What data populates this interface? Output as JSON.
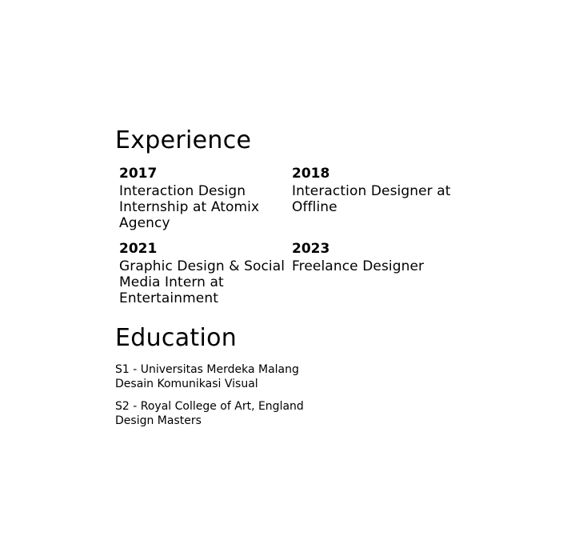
{
  "experience": {
    "title": "Experience",
    "items": [
      {
        "year": "2017",
        "role": "Interaction Design Internship at Atomix Agency"
      },
      {
        "year": "2018",
        "role": "Interaction Designer at Offline"
      },
      {
        "year": "2021",
        "role": "Graphic Design & Social Media Intern at Entertainment"
      },
      {
        "year": "2023",
        "role": "Freelance Designer"
      }
    ]
  },
  "education": {
    "title": "Education",
    "items": [
      {
        "degree": "S1 - Universitas Merdeka Malang",
        "program": "Desain Komunikasi Visual"
      },
      {
        "degree": "S2 - Royal College of Art, England",
        "program": "Design Masters"
      }
    ]
  }
}
